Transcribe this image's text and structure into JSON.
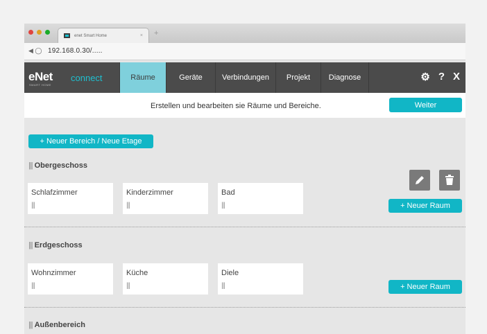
{
  "browser": {
    "tab_title": "enet Smart Home",
    "tab_close": "×",
    "new_tab": "+",
    "nav_glyph": "◀ ◯",
    "url": "192.168.0.30/....."
  },
  "app": {
    "logo": "eNet",
    "logo_sub": "SMART HOME",
    "logo_connect": "connect",
    "tabs": [
      "Räume",
      "Geräte",
      "Verbindungen",
      "Projekt",
      "Diagnose"
    ],
    "active_tab": "Räume",
    "icons": {
      "settings": "⚙",
      "help": "?",
      "close": "X"
    }
  },
  "subheader": {
    "text": "Erstellen und bearbeiten sie Räume und Bereiche.",
    "next_button": "Weiter"
  },
  "main": {
    "new_area_button": "+ Neuer Bereich / Neue Etage",
    "handle": "|||",
    "new_room_button": "+ Neuer Raum",
    "sections": [
      {
        "title": "Obergeschoss",
        "rooms": [
          "Schlafzimmer",
          "Kinderzimmer",
          "Bad"
        ]
      },
      {
        "title": "Erdgeschoss",
        "rooms": [
          "Wohnzimmer",
          "Küche",
          "Diele"
        ]
      },
      {
        "title": "Außenbereich",
        "rooms": []
      }
    ]
  },
  "colors": {
    "accent": "#11b6c6",
    "nav_bg": "#4b4b4b",
    "active_tab": "#7fd0dc"
  }
}
